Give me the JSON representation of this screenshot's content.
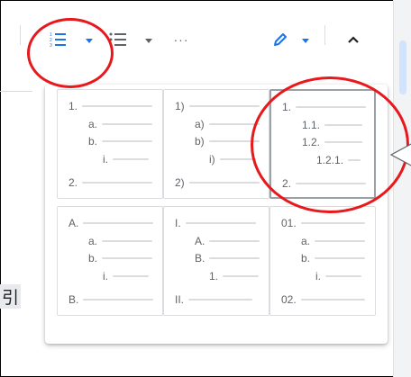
{
  "toolbar": {
    "numbered_list_icon": "numbered-list-icon",
    "bulleted_list_icon": "bulleted-list-icon",
    "more_label": "···",
    "pen_color": "#1a73e8"
  },
  "side_text": "引",
  "list_styles": [
    {
      "rows": [
        "1.",
        "a.",
        "b.",
        "i.",
        "2."
      ]
    },
    {
      "rows": [
        "1)",
        "a)",
        "b)",
        "i)",
        "2)"
      ]
    },
    {
      "rows": [
        "1.",
        "1.1.",
        "1.2.",
        "1.2.1.",
        "2."
      ],
      "selected": true
    },
    {
      "rows": [
        "A.",
        "a.",
        "b.",
        "i.",
        "B."
      ]
    },
    {
      "rows": [
        "I.",
        "A.",
        "B.",
        "1.",
        "II."
      ]
    },
    {
      "rows": [
        "01.",
        "a.",
        "b.",
        "i.",
        "02."
      ]
    }
  ],
  "colors": {
    "accent": "#1a73e8",
    "annotation": "#e8191c",
    "line": "#dadce0",
    "text": "#5f6368"
  }
}
